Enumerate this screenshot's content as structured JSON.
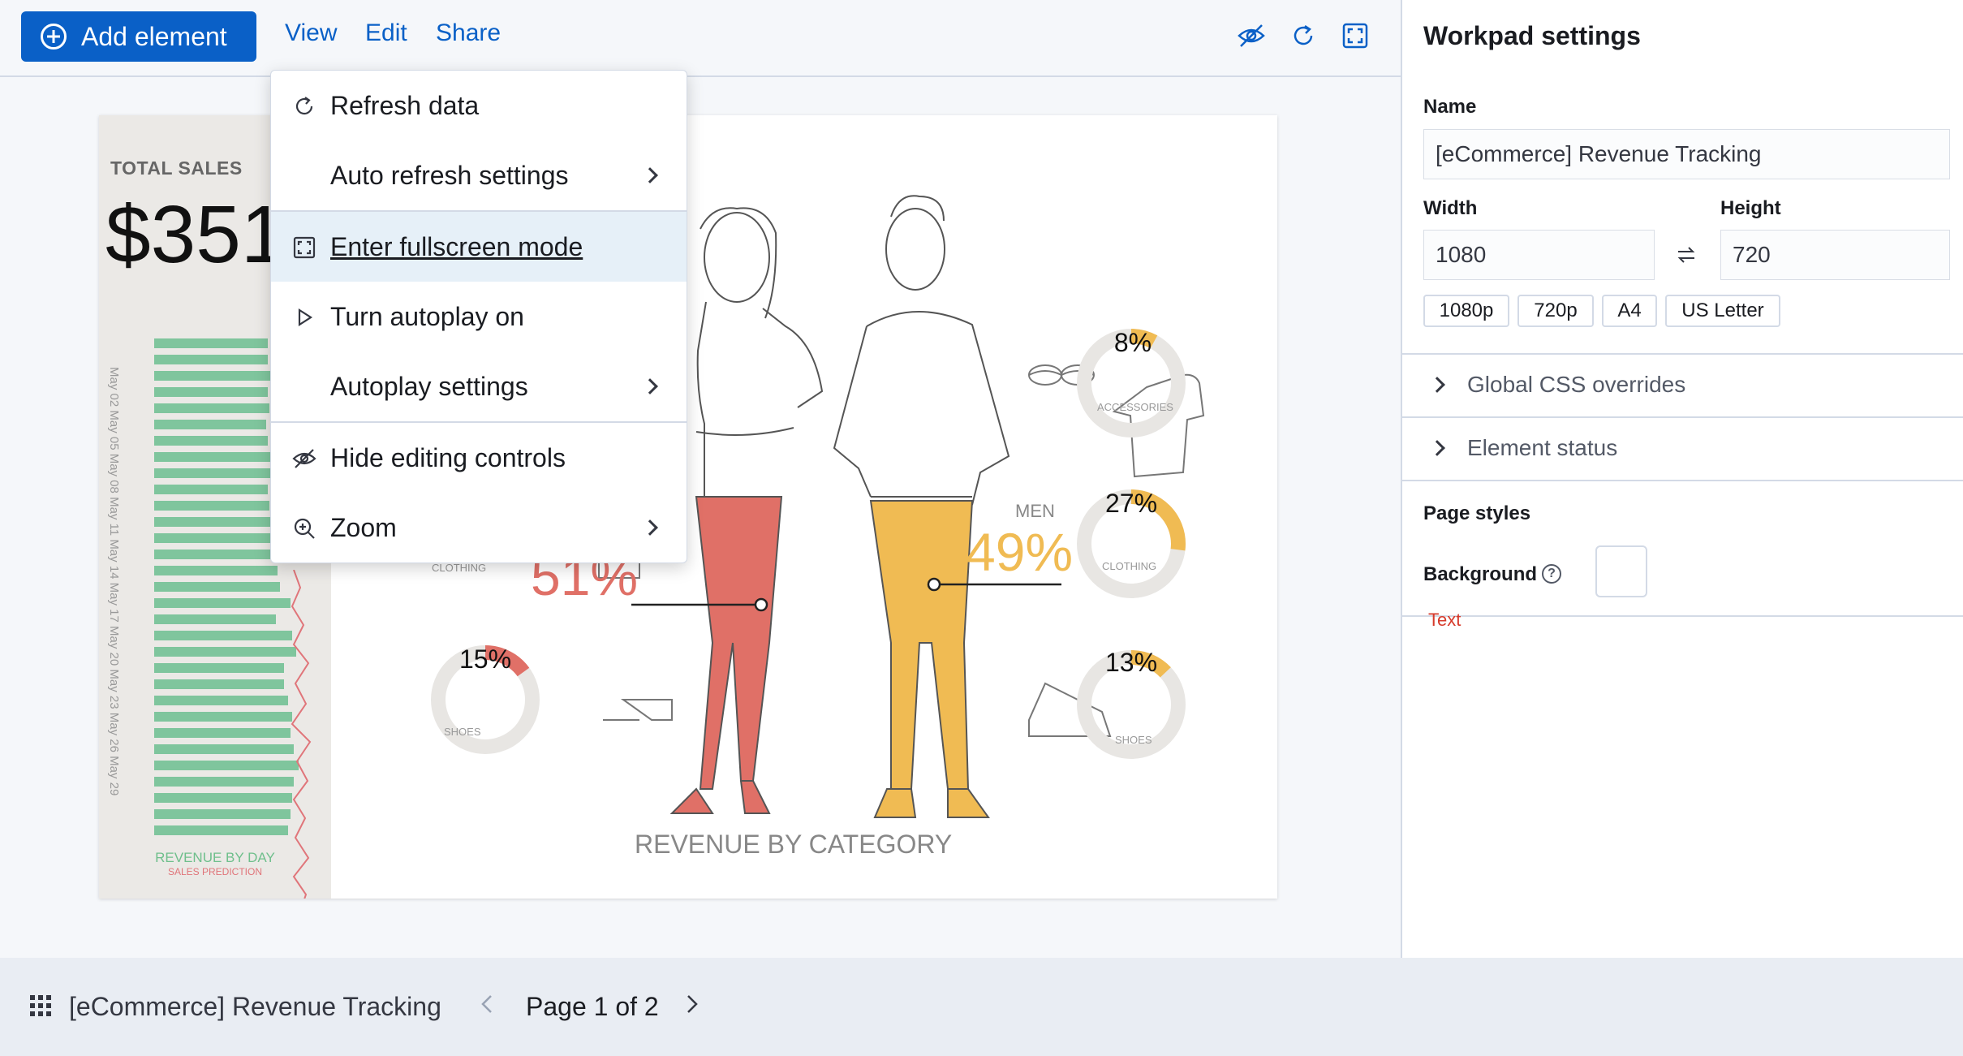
{
  "toolbar": {
    "add_element_label": "Add element",
    "view_label": "View",
    "edit_label": "Edit",
    "share_label": "Share",
    "icons": [
      "eye-closed-icon",
      "refresh-icon",
      "fullscreen-icon"
    ]
  },
  "view_menu": {
    "items": [
      {
        "label": "Refresh data",
        "icon": "refresh-icon"
      },
      {
        "label": "Auto refresh settings",
        "submenu": true
      },
      {
        "label": "Enter fullscreen mode",
        "icon": "fullscreen-icon",
        "active": true
      },
      {
        "label": "Turn autoplay on",
        "icon": "play-icon"
      },
      {
        "label": "Autoplay settings",
        "submenu": true
      },
      {
        "label": "Hide editing controls",
        "icon": "eye-closed-icon"
      },
      {
        "label": "Zoom",
        "icon": "zoom-in-icon",
        "submenu": true
      }
    ]
  },
  "workpad": {
    "total_sales_label": "TOTAL SALES",
    "total_sales_value": "$351",
    "dates": "May 02 May 05 May 08 May 11 May 14 May 17 May 20 May 23 May 26 May 29",
    "revenue_by_day": "REVENUE BY DAY",
    "sales_prediction": "SALES PREDICTION",
    "revenue_by_category": "REVENUE BY CATEGORY",
    "women_pct": "51%",
    "men_label": "MEN",
    "men_pct": "49%",
    "women_clothing_label": "CLOTHING",
    "women_shoes_pct": "15%",
    "women_shoes_label": "SHOES",
    "men_accessories_pct": "8%",
    "men_accessories_label": "ACCESSORIES",
    "men_clothing_pct": "27%",
    "men_clothing_label": "CLOTHING",
    "men_shoes_pct": "13%",
    "men_shoes_label": "SHOES",
    "donut_levels": {
      "women_shoes": 0.15,
      "men_accessories": 0.08,
      "men_clothing": 0.27,
      "men_shoes": 0.13
    },
    "colors": {
      "women": "#e07067",
      "men": "#f0bb53",
      "bars": "#7fc59d",
      "prediction": "#e0757a"
    }
  },
  "sidebar": {
    "title": "Workpad settings",
    "name_label": "Name",
    "name_value": "[eCommerce] Revenue Tracking",
    "width_label": "Width",
    "width_value": "1080",
    "height_label": "Height",
    "height_value": "720",
    "presets": [
      "1080p",
      "720p",
      "A4",
      "US Letter"
    ],
    "global_css_label": "Global CSS overrides",
    "element_status_label": "Element status",
    "page_styles_label": "Page styles",
    "background_label": "Background",
    "text_label": "Text"
  },
  "bottom_bar": {
    "workpad_title": "[eCommerce] Revenue Tracking",
    "page_label": "Page 1 of 2"
  }
}
